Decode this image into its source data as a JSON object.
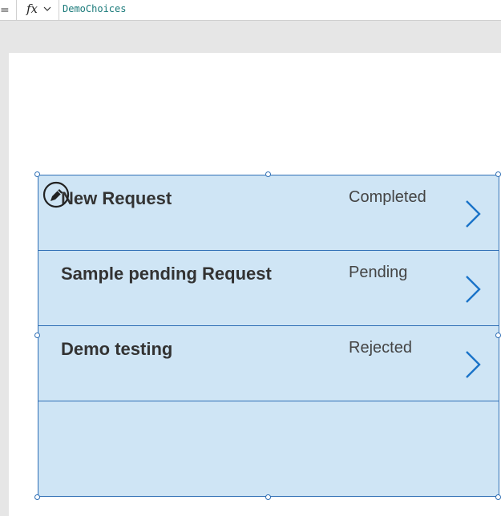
{
  "formula_bar": {
    "equals": "=",
    "fx_label": "fx",
    "formula": "DemoChoices"
  },
  "gallery": {
    "rows": [
      {
        "title": "New Request",
        "status": "Completed"
      },
      {
        "title": "Sample pending Request",
        "status": "Pending"
      },
      {
        "title": "Demo testing",
        "status": "Rejected"
      }
    ]
  },
  "icons": {
    "fx_dropdown": "chevron-down-icon",
    "row_nav": "chevron-right-icon",
    "edit": "pencil-icon"
  },
  "colors": {
    "gallery_fill": "#cfe5f5",
    "gallery_border": "#2f6fb5",
    "formula_text": "#1a7a7a",
    "chevron": "#1a73c8"
  }
}
